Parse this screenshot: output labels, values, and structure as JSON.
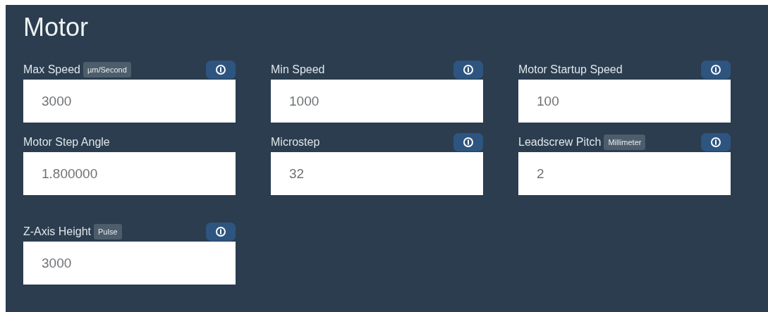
{
  "title": "Motor",
  "rows": [
    {
      "fields": [
        {
          "label": "Max Speed",
          "unit": "µm/Second",
          "info": true,
          "value": "3000"
        },
        {
          "label": "Min Speed",
          "info": true,
          "value": "1000"
        },
        {
          "label": "Motor Startup Speed",
          "info": true,
          "value": "100"
        }
      ]
    },
    {
      "fields": [
        {
          "label": "Motor Step Angle",
          "info": false,
          "value": "1.800000"
        },
        {
          "label": "Microstep",
          "info": true,
          "value": "32"
        },
        {
          "label": "Leadscrew Pitch",
          "unit": "Millimeter",
          "info": true,
          "value": "2"
        }
      ]
    },
    {
      "fields": [
        {
          "label": "Z-Axis Height",
          "unit": "Pulse",
          "info": true,
          "value": "3000"
        }
      ]
    }
  ]
}
